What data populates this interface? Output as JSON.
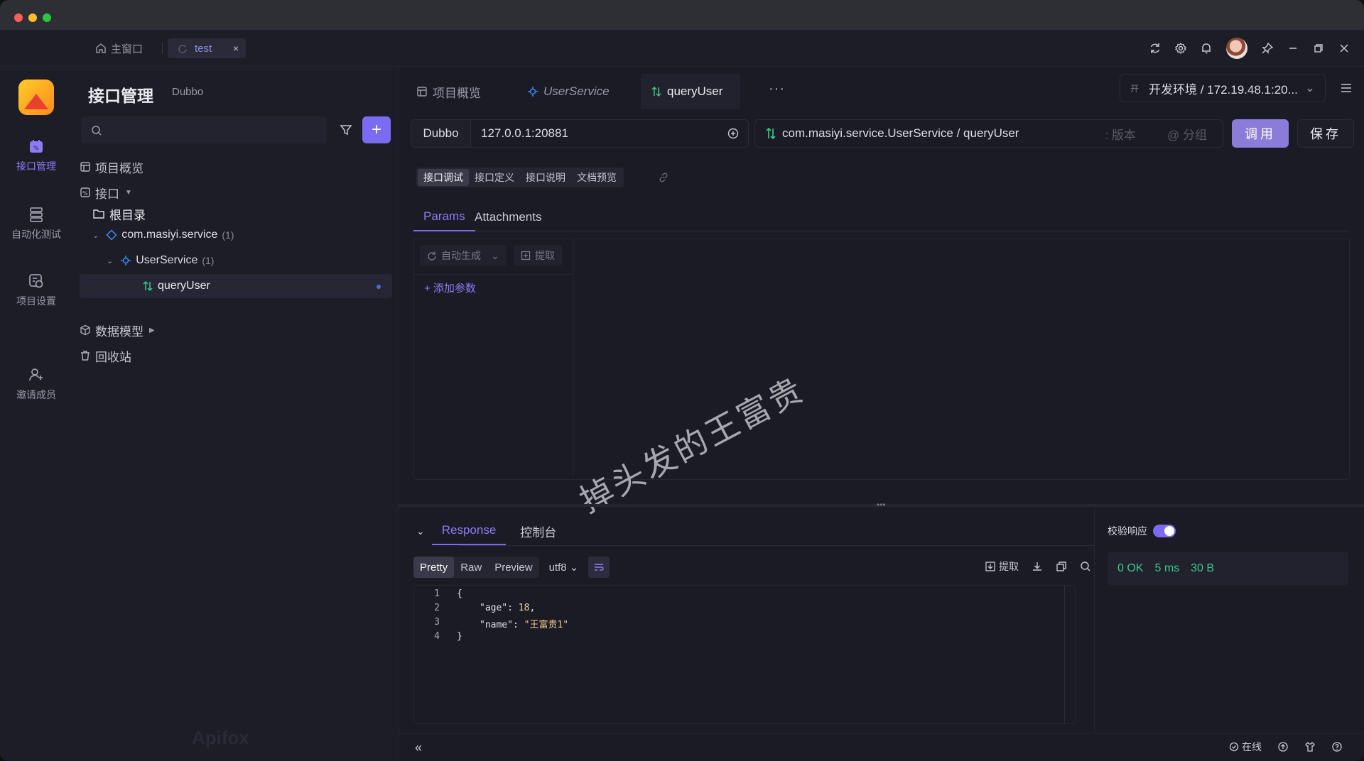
{
  "window_tabs": {
    "home_label": "主窗口",
    "test_label": "test",
    "close_glyph": "×"
  },
  "rail": {
    "items": [
      {
        "label": "接口管理",
        "icon": "api-icon",
        "active": true
      },
      {
        "label": "自动化测试",
        "icon": "automation-icon"
      },
      {
        "label": "项目设置",
        "icon": "settings-icon"
      },
      {
        "label": "邀请成员",
        "icon": "invite-user-icon"
      }
    ]
  },
  "sidebar": {
    "title": "接口管理",
    "subtitle": "Dubbo",
    "add_glyph": "+",
    "tree": {
      "overview": "项目概览",
      "api": "接口",
      "root": "根目录",
      "package": "com.masiyi.service",
      "package_count": "(1)",
      "service": "UserService",
      "service_count": "(1)",
      "method": "queryUser",
      "data_model": "数据模型",
      "recycle": "回收站"
    },
    "brand_watermark": "Apifox"
  },
  "main": {
    "tabs": {
      "overview": "项目概览",
      "service": "UserService",
      "method": "queryUser",
      "more": "···"
    },
    "env": {
      "badge": "开",
      "label": "开发环境 / 172.19.48.1:20..."
    },
    "request": {
      "protocol": "Dubbo",
      "address": "127.0.0.1:20881",
      "service_path": "com.masiyi.service.UserService / queryUser",
      "version_placeholder": ": 版本",
      "group_placeholder": "@ 分组",
      "invoke_label": "调用",
      "save_label": "保存"
    },
    "doc_tabs": [
      "接口调试",
      "接口定义",
      "接口说明",
      "文档预览"
    ],
    "param_tabs": [
      "Params",
      "Attachments"
    ],
    "params": {
      "auto_generate": "自动生成",
      "extract": "提取",
      "add_param": "+ 添加参数"
    },
    "watermark": "掉头发的王富贵"
  },
  "response": {
    "tabs": [
      "Response",
      "控制台"
    ],
    "formats": [
      "Pretty",
      "Raw",
      "Preview"
    ],
    "encoding": "utf8",
    "extract": "提取",
    "code_lines": [
      {
        "n": "1",
        "text": "{"
      },
      {
        "n": "2",
        "key": "\"age\"",
        "value": "18",
        "kind": "num"
      },
      {
        "n": "3",
        "key": "\"name\"",
        "value": "\"王富贵1\"",
        "kind": "str"
      },
      {
        "n": "4",
        "text": "}"
      }
    ],
    "verify_label": "校验响应",
    "status": {
      "code": "0 OK",
      "time": "5 ms",
      "size": "30 B"
    }
  },
  "bottom": {
    "collapse": "«",
    "online": "在线"
  },
  "colors": {
    "accent": "#7b6bf0",
    "success": "#3cc88a"
  }
}
